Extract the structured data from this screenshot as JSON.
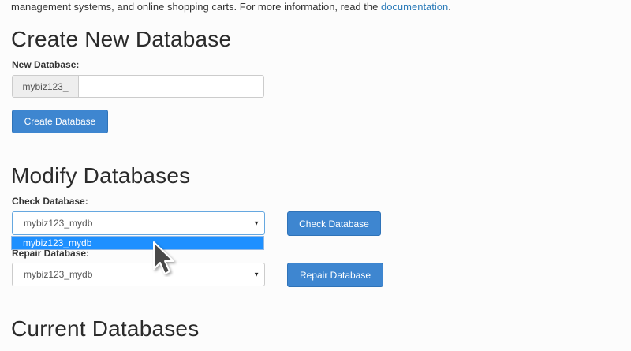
{
  "intro": {
    "text": "management systems, and online shopping carts. For more information, read the ",
    "link": "documentation",
    "suffix": "."
  },
  "create": {
    "heading": "Create New Database",
    "label": "New Database:",
    "prefix": "mybiz123_",
    "input_value": "",
    "button": "Create Database"
  },
  "modify": {
    "heading": "Modify Databases",
    "check_label": "Check Database:",
    "check_selected": "mybiz123_mydb",
    "check_button": "Check Database",
    "dropdown_option": "mybiz123_mydb",
    "repair_label": "Repair Database:",
    "repair_selected": "mybiz123_mydb",
    "repair_button": "Repair Database"
  },
  "current": {
    "heading": "Current Databases"
  },
  "colors": {
    "button": "#3e86d0",
    "link": "#2a7ab8",
    "dropdown_highlight": "#1e90ff"
  },
  "icons": {
    "caret": "chevron-down-icon",
    "pointer": "mouse-pointer-icon"
  }
}
